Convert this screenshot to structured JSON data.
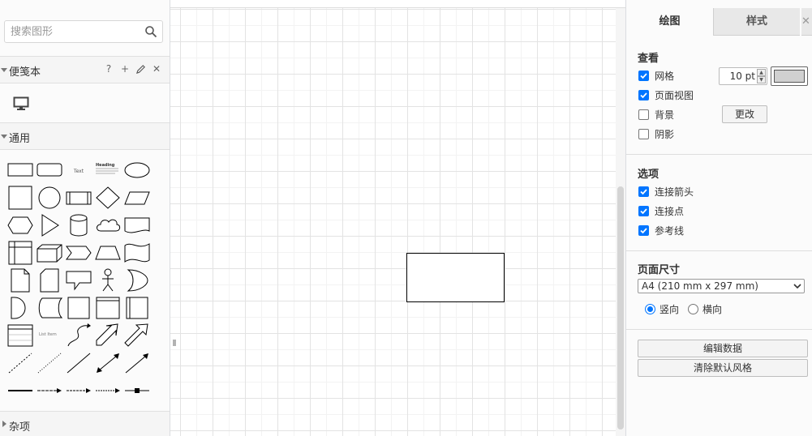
{
  "search": {
    "placeholder": "搜索图形"
  },
  "sidebar": {
    "scratchpad": {
      "title": "便笺本",
      "help": "?",
      "add": "+",
      "edit_icon": "pencil-icon",
      "close": "✕"
    },
    "general": {
      "title": "通用"
    },
    "misc": {
      "title": "杂项"
    },
    "shape_labels": {
      "text": "Text",
      "heading": "Heading",
      "list_item": "List Item"
    }
  },
  "panel": {
    "tabs": {
      "diagram": "绘图",
      "style": "样式",
      "close": "✕"
    },
    "view": {
      "title": "查看",
      "grid": {
        "label": "网格",
        "checked": true,
        "size": "10 pt",
        "color": "#d0d0d0"
      },
      "page_view": {
        "label": "页面视图",
        "checked": true
      },
      "background": {
        "label": "背景",
        "checked": false,
        "change_button": "更改"
      },
      "shadow": {
        "label": "阴影",
        "checked": false
      }
    },
    "options": {
      "title": "选项",
      "connection_arrows": {
        "label": "连接箭头",
        "checked": true
      },
      "connection_points": {
        "label": "连接点",
        "checked": true
      },
      "guides": {
        "label": "参考线",
        "checked": true
      }
    },
    "page_size": {
      "title": "页面尺寸",
      "selected": "A4 (210 mm x 297 mm)",
      "portrait": {
        "label": "竖向",
        "checked": true
      },
      "landscape": {
        "label": "横向",
        "checked": false
      }
    },
    "actions": {
      "edit_data": "编辑数据",
      "clear_default_style": "清除默认风格"
    }
  },
  "colors": {
    "accent": "#0075ff",
    "grid_line": "#e3e3e3",
    "panel_bg": "#fbfbfb"
  }
}
